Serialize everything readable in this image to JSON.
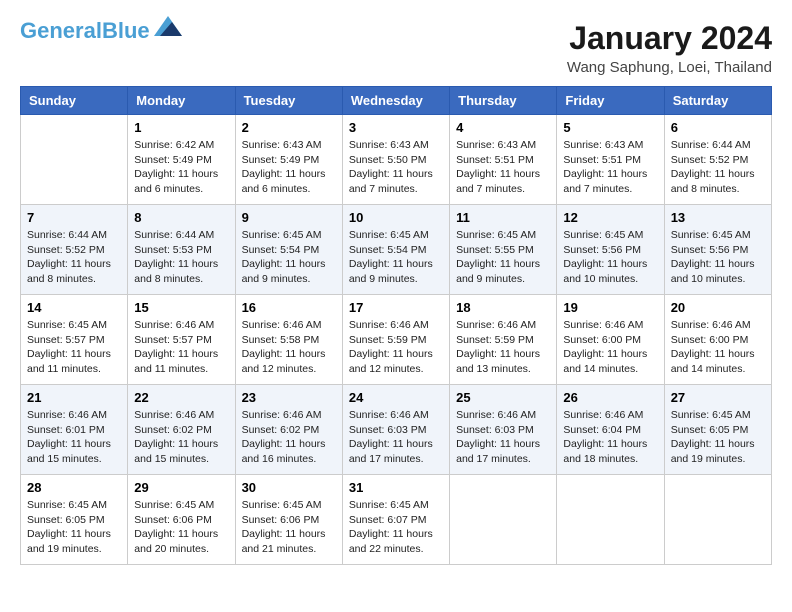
{
  "header": {
    "logo_line1": "General",
    "logo_line2": "Blue",
    "month_title": "January 2024",
    "location": "Wang Saphung, Loei, Thailand"
  },
  "weekdays": [
    "Sunday",
    "Monday",
    "Tuesday",
    "Wednesday",
    "Thursday",
    "Friday",
    "Saturday"
  ],
  "weeks": [
    [
      {
        "day": "",
        "info": ""
      },
      {
        "day": "1",
        "info": "Sunrise: 6:42 AM\nSunset: 5:49 PM\nDaylight: 11 hours\nand 6 minutes."
      },
      {
        "day": "2",
        "info": "Sunrise: 6:43 AM\nSunset: 5:49 PM\nDaylight: 11 hours\nand 6 minutes."
      },
      {
        "day": "3",
        "info": "Sunrise: 6:43 AM\nSunset: 5:50 PM\nDaylight: 11 hours\nand 7 minutes."
      },
      {
        "day": "4",
        "info": "Sunrise: 6:43 AM\nSunset: 5:51 PM\nDaylight: 11 hours\nand 7 minutes."
      },
      {
        "day": "5",
        "info": "Sunrise: 6:43 AM\nSunset: 5:51 PM\nDaylight: 11 hours\nand 7 minutes."
      },
      {
        "day": "6",
        "info": "Sunrise: 6:44 AM\nSunset: 5:52 PM\nDaylight: 11 hours\nand 8 minutes."
      }
    ],
    [
      {
        "day": "7",
        "info": "Sunrise: 6:44 AM\nSunset: 5:52 PM\nDaylight: 11 hours\nand 8 minutes."
      },
      {
        "day": "8",
        "info": "Sunrise: 6:44 AM\nSunset: 5:53 PM\nDaylight: 11 hours\nand 8 minutes."
      },
      {
        "day": "9",
        "info": "Sunrise: 6:45 AM\nSunset: 5:54 PM\nDaylight: 11 hours\nand 9 minutes."
      },
      {
        "day": "10",
        "info": "Sunrise: 6:45 AM\nSunset: 5:54 PM\nDaylight: 11 hours\nand 9 minutes."
      },
      {
        "day": "11",
        "info": "Sunrise: 6:45 AM\nSunset: 5:55 PM\nDaylight: 11 hours\nand 9 minutes."
      },
      {
        "day": "12",
        "info": "Sunrise: 6:45 AM\nSunset: 5:56 PM\nDaylight: 11 hours\nand 10 minutes."
      },
      {
        "day": "13",
        "info": "Sunrise: 6:45 AM\nSunset: 5:56 PM\nDaylight: 11 hours\nand 10 minutes."
      }
    ],
    [
      {
        "day": "14",
        "info": "Sunrise: 6:45 AM\nSunset: 5:57 PM\nDaylight: 11 hours\nand 11 minutes."
      },
      {
        "day": "15",
        "info": "Sunrise: 6:46 AM\nSunset: 5:57 PM\nDaylight: 11 hours\nand 11 minutes."
      },
      {
        "day": "16",
        "info": "Sunrise: 6:46 AM\nSunset: 5:58 PM\nDaylight: 11 hours\nand 12 minutes."
      },
      {
        "day": "17",
        "info": "Sunrise: 6:46 AM\nSunset: 5:59 PM\nDaylight: 11 hours\nand 12 minutes."
      },
      {
        "day": "18",
        "info": "Sunrise: 6:46 AM\nSunset: 5:59 PM\nDaylight: 11 hours\nand 13 minutes."
      },
      {
        "day": "19",
        "info": "Sunrise: 6:46 AM\nSunset: 6:00 PM\nDaylight: 11 hours\nand 14 minutes."
      },
      {
        "day": "20",
        "info": "Sunrise: 6:46 AM\nSunset: 6:00 PM\nDaylight: 11 hours\nand 14 minutes."
      }
    ],
    [
      {
        "day": "21",
        "info": "Sunrise: 6:46 AM\nSunset: 6:01 PM\nDaylight: 11 hours\nand 15 minutes."
      },
      {
        "day": "22",
        "info": "Sunrise: 6:46 AM\nSunset: 6:02 PM\nDaylight: 11 hours\nand 15 minutes."
      },
      {
        "day": "23",
        "info": "Sunrise: 6:46 AM\nSunset: 6:02 PM\nDaylight: 11 hours\nand 16 minutes."
      },
      {
        "day": "24",
        "info": "Sunrise: 6:46 AM\nSunset: 6:03 PM\nDaylight: 11 hours\nand 17 minutes."
      },
      {
        "day": "25",
        "info": "Sunrise: 6:46 AM\nSunset: 6:03 PM\nDaylight: 11 hours\nand 17 minutes."
      },
      {
        "day": "26",
        "info": "Sunrise: 6:46 AM\nSunset: 6:04 PM\nDaylight: 11 hours\nand 18 minutes."
      },
      {
        "day": "27",
        "info": "Sunrise: 6:45 AM\nSunset: 6:05 PM\nDaylight: 11 hours\nand 19 minutes."
      }
    ],
    [
      {
        "day": "28",
        "info": "Sunrise: 6:45 AM\nSunset: 6:05 PM\nDaylight: 11 hours\nand 19 minutes."
      },
      {
        "day": "29",
        "info": "Sunrise: 6:45 AM\nSunset: 6:06 PM\nDaylight: 11 hours\nand 20 minutes."
      },
      {
        "day": "30",
        "info": "Sunrise: 6:45 AM\nSunset: 6:06 PM\nDaylight: 11 hours\nand 21 minutes."
      },
      {
        "day": "31",
        "info": "Sunrise: 6:45 AM\nSunset: 6:07 PM\nDaylight: 11 hours\nand 22 minutes."
      },
      {
        "day": "",
        "info": ""
      },
      {
        "day": "",
        "info": ""
      },
      {
        "day": "",
        "info": ""
      }
    ]
  ]
}
